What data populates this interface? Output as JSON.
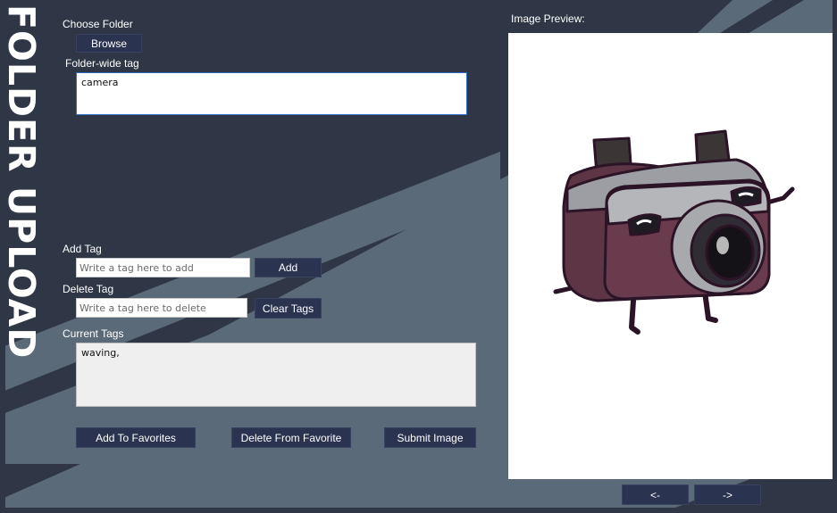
{
  "side_title": "FOLDER UPLOAD",
  "choose_folder": {
    "label": "Choose Folder",
    "browse_label": "Browse"
  },
  "folder_tag": {
    "label": "Folder-wide tag",
    "value": "camera"
  },
  "add_tag": {
    "label": "Add Tag",
    "placeholder": "Write a tag here to add",
    "button": "Add"
  },
  "delete_tag": {
    "label": "Delete Tag",
    "placeholder": "Write a tag here to delete",
    "button": "Clear Tags"
  },
  "current_tags": {
    "label": "Current Tags",
    "value": "waving,"
  },
  "actions": {
    "add_favorites": "Add To Favorites",
    "delete_favorite": "Delete From Favorite",
    "submit": "Submit Image"
  },
  "preview": {
    "label": "Image Preview:",
    "image": "waving-camera-mascot"
  },
  "nav": {
    "prev": "<-",
    "next": "->"
  },
  "colors": {
    "background": "#2f3747",
    "stripe_light": "#5a6a78",
    "button": "#2a3350",
    "accent_border": "#2d6cc0"
  }
}
